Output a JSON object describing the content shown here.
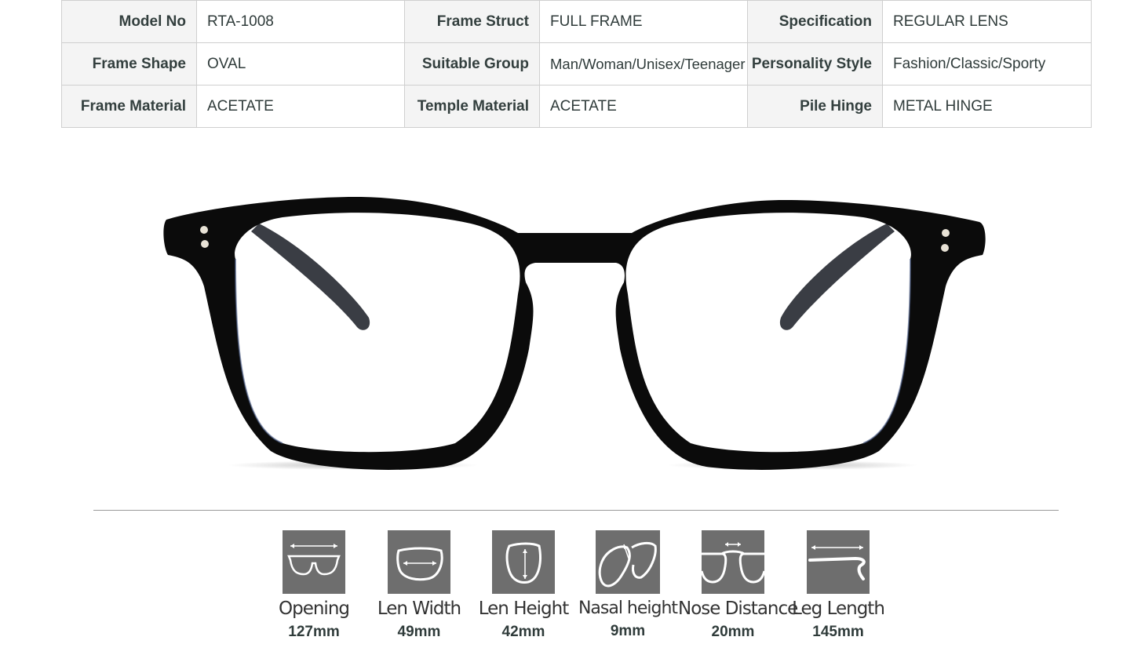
{
  "specs": {
    "rows": [
      [
        {
          "label": "Model No",
          "value": "RTA-1008"
        },
        {
          "label": "Frame Struct",
          "value": "FULL FRAME"
        },
        {
          "label": "Specification",
          "value": "REGULAR LENS"
        }
      ],
      [
        {
          "label": "Frame Shape",
          "value": "OVAL"
        },
        {
          "label": "Suitable Group",
          "value": "Man/Woman/Unisex/Teenager"
        },
        {
          "label": "Personality Style",
          "value": "Fashion/Classic/Sporty"
        }
      ],
      [
        {
          "label": "Frame Material",
          "value": "ACETATE"
        },
        {
          "label": "Temple Material",
          "value": "ACETATE"
        },
        {
          "label": "Pile Hinge",
          "value": "METAL HINGE"
        }
      ]
    ]
  },
  "product_image": {
    "icon": "eyeglasses-front-icon",
    "frame_color": "#0b0b0b"
  },
  "measurements": [
    {
      "label": "Opening",
      "value": "127mm",
      "icon": "opening-width-icon"
    },
    {
      "label": "Len Width",
      "value": "49mm",
      "icon": "lens-width-icon"
    },
    {
      "label": "Len Height",
      "value": "42mm",
      "icon": "lens-height-icon"
    },
    {
      "label": "Nasal height",
      "value": "9mm",
      "icon": "nasal-height-icon"
    },
    {
      "label": "Nose Distance",
      "value": "20mm",
      "icon": "nose-distance-icon"
    },
    {
      "label": "Leg Length",
      "value": "145mm",
      "icon": "leg-length-icon"
    }
  ]
}
